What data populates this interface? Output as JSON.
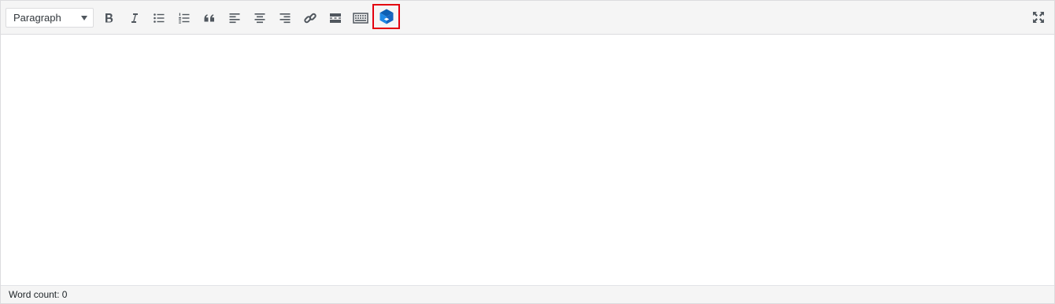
{
  "toolbar": {
    "format_select": {
      "selected": "Paragraph",
      "icon": "dropdown-arrow-icon"
    },
    "buttons": [
      {
        "id": "bold",
        "icon": "bold-icon"
      },
      {
        "id": "italic",
        "icon": "italic-icon"
      },
      {
        "id": "bulleted-list",
        "icon": "bulleted-list-icon"
      },
      {
        "id": "numbered-list",
        "icon": "numbered-list-icon"
      },
      {
        "id": "blockquote",
        "icon": "blockquote-icon"
      },
      {
        "id": "align-left",
        "icon": "align-left-icon"
      },
      {
        "id": "align-center",
        "icon": "align-center-icon"
      },
      {
        "id": "align-right",
        "icon": "align-right-icon"
      },
      {
        "id": "insert-link",
        "icon": "link-icon"
      },
      {
        "id": "read-more",
        "icon": "read-more-icon"
      },
      {
        "id": "toolbar-toggle",
        "icon": "keyboard-icon"
      },
      {
        "id": "plugin-cube",
        "icon": "blue-cube-icon",
        "highlighted": true
      }
    ],
    "fullscreen": {
      "icon": "fullscreen-icon"
    }
  },
  "colors": {
    "icon": "#50575e",
    "highlight_border": "#e3000f",
    "cube_blue": "#1e88e5",
    "cube_dark": "#0d5fb3"
  },
  "content": {
    "text": ""
  },
  "status": {
    "word_count": "Word count: 0"
  }
}
